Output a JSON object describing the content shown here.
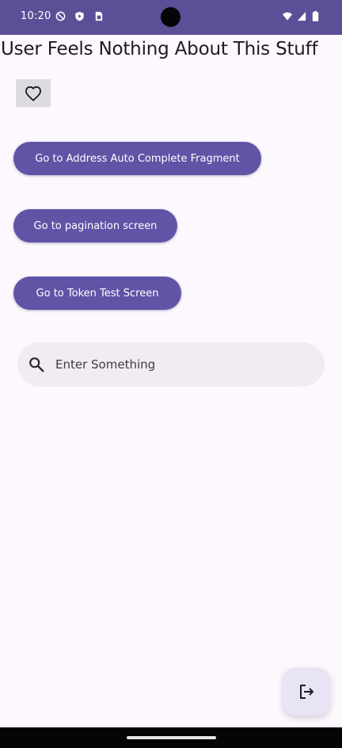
{
  "status_bar": {
    "time": "10:20",
    "background": "#5c4f97",
    "left_icons": [
      "do-not-disturb-icon",
      "shield-play-icon",
      "sim-card-icon"
    ],
    "right_icons": [
      "wifi-icon",
      "cellular-signal-icon",
      "battery-icon"
    ]
  },
  "header": {
    "title": "User Feels Nothing About This Stuff"
  },
  "favorite": {
    "icon": "heart-outline-icon"
  },
  "buttons": {
    "address": "Go to Address Auto Complete Fragment",
    "pagination": "Go to pagination screen",
    "token": "Go to Token Test Screen"
  },
  "search": {
    "icon": "search-icon",
    "placeholder": "Enter Something",
    "value": ""
  },
  "fab": {
    "icon": "logout-icon"
  },
  "colors": {
    "primary": "#5f54a6",
    "surface": "#fdf8fd",
    "search_container": "#f1ebf3",
    "fab_container": "#e8e3f5"
  }
}
